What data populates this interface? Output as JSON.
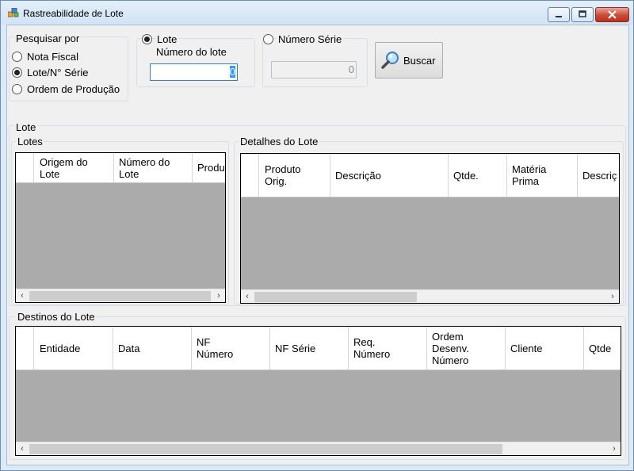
{
  "window": {
    "title": "Rastreabilidade de Lote"
  },
  "search": {
    "group_label": "Pesquisar por",
    "options": [
      "Nota Fiscal",
      "Lote/N° Série",
      "Ordem de Produção"
    ],
    "selected": "Lote/N° Série",
    "lote_option": "Lote",
    "lote_field_label": "Número do lote",
    "lote_value": "0",
    "serie_option": "Número Série",
    "serie_value": "0",
    "button_label": "Buscar"
  },
  "lote_group": {
    "label": "Lote"
  },
  "lotes": {
    "label": "Lotes",
    "columns": [
      "Origem do\nLote",
      "Número do\nLote",
      "Produ"
    ]
  },
  "detalhes": {
    "label": "Detalhes do Lote",
    "columns": [
      "Produto\nOrig.",
      "Descrição",
      "Qtde.",
      "Matéria\nPrima",
      "Descriç"
    ]
  },
  "destinos": {
    "label": "Destinos do Lote",
    "columns": [
      "Entidade",
      "Data",
      "NF\nNúmero",
      "NF Série",
      "Req.\nNúmero",
      "Ordem\nDesenv.\nNúmero",
      "Cliente",
      "Qtde"
    ]
  },
  "colors": {
    "grid_bg": "#ababab",
    "selection": "#3399ff",
    "close_button": "#c74b36"
  }
}
